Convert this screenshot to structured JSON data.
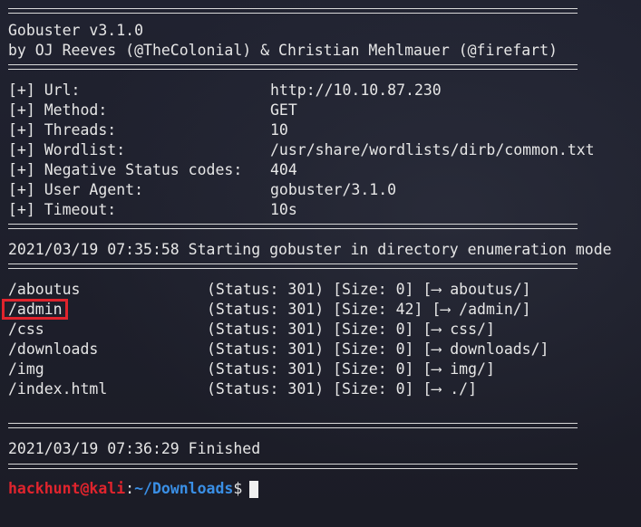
{
  "banner": {
    "line1": "Gobuster v3.1.0",
    "line2": "by OJ Reeves (@TheColonial) & Christian Mehlmauer (@firefart)"
  },
  "config": [
    {
      "label": "[+] Url:",
      "value": "http://10.10.87.230"
    },
    {
      "label": "[+] Method:",
      "value": "GET"
    },
    {
      "label": "[+] Threads:",
      "value": "10"
    },
    {
      "label": "[+] Wordlist:",
      "value": "/usr/share/wordlists/dirb/common.txt"
    },
    {
      "label": "[+] Negative Status codes:",
      "value": "404"
    },
    {
      "label": "[+] User Agent:",
      "value": "gobuster/3.1.0"
    },
    {
      "label": "[+] Timeout:",
      "value": "10s"
    }
  ],
  "start_message": "2021/03/19 07:35:58 Starting gobuster in directory enumeration mode",
  "results": [
    {
      "path": "/aboutus",
      "info": "(Status: 301) [Size: 0] [⟶ aboutus/]"
    },
    {
      "path": "/admin",
      "info": "(Status: 301) [Size: 42] [⟶ /admin/]"
    },
    {
      "path": "/css",
      "info": "(Status: 301) [Size: 0] [⟶ css/]"
    },
    {
      "path": "/downloads",
      "info": "(Status: 301) [Size: 0] [⟶ downloads/]"
    },
    {
      "path": "/img",
      "info": "(Status: 301) [Size: 0] [⟶ img/]"
    },
    {
      "path": "/index.html",
      "info": "(Status: 301) [Size: 0] [⟶ ./]"
    }
  ],
  "finish_message": "2021/03/19 07:36:29 Finished",
  "prompt": {
    "user_host": "hackhunt@kali",
    "separator": ":",
    "path": "~/Downloads",
    "symbol": "$"
  },
  "colors": {
    "background": "#1e1f29",
    "text": "#e6e6e6",
    "prompt_user": "#e0242d",
    "prompt_path": "#3a8fe6",
    "highlight_box": "#e0242d"
  }
}
